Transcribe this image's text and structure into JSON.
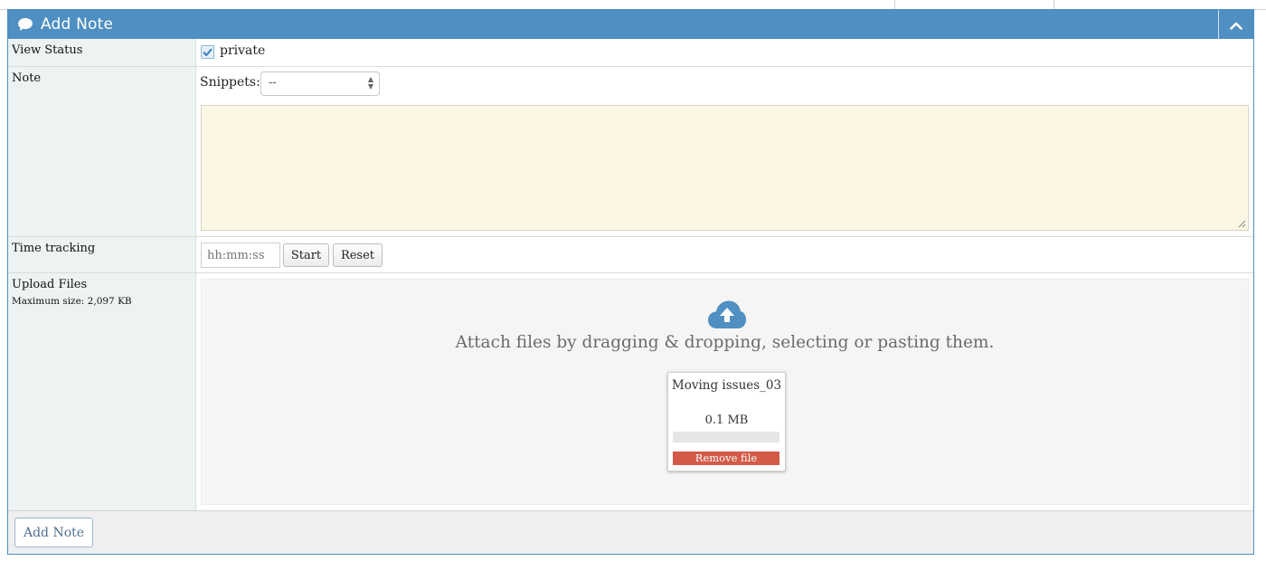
{
  "colors": {
    "header_bg": "#4f8fc2",
    "label_bg": "#edf3f3",
    "textarea_bg": "#fcf7e4",
    "dropzone_bg": "#f5f5f5",
    "remove_btn": "#d35a48",
    "cloud_icon": "#4f8fc2"
  },
  "header": {
    "title": "Add Note",
    "icon": "comment-icon",
    "collapse_icon": "chevron-up-icon"
  },
  "view_status": {
    "label": "View Status",
    "checkbox_checked": true,
    "checkbox_label": "private"
  },
  "note": {
    "label": "Note",
    "snippets_label": "Snippets:",
    "snippets_selected": "--",
    "textarea_value": ""
  },
  "time_tracking": {
    "label": "Time tracking",
    "input_placeholder": "hh:mm:ss",
    "start_label": "Start",
    "reset_label": "Reset"
  },
  "upload": {
    "label": "Upload Files",
    "max_size": "Maximum size: 2,097 KB",
    "icon": "cloud-upload-icon",
    "dropzone_text": "Attach files by dragging & dropping, selecting or pasting them.",
    "files": [
      {
        "name": "Moving issues_03",
        "size": "0.1 MB",
        "progress": 0,
        "remove_label": "Remove file"
      }
    ]
  },
  "footer": {
    "submit_label": "Add Note"
  }
}
